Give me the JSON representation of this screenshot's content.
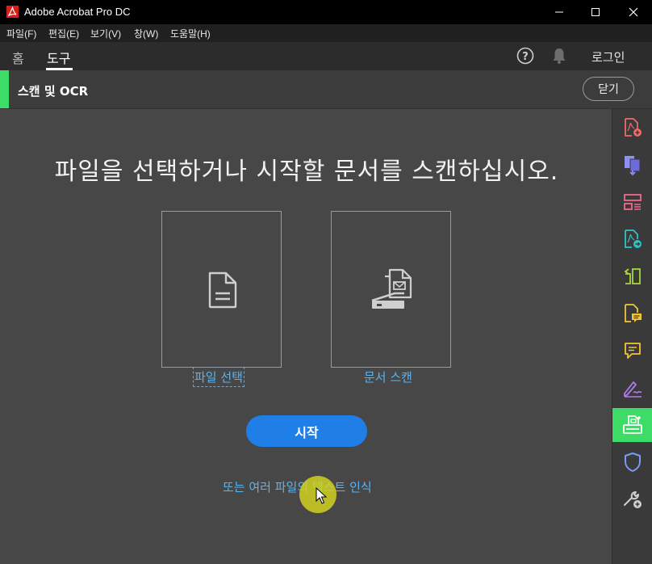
{
  "window": {
    "title": "Adobe Acrobat Pro DC"
  },
  "menu": [
    "파일(F)",
    "편집(E)",
    "보기(V)",
    "창(W)",
    "도움말(H)"
  ],
  "nav": {
    "tabs": [
      {
        "label": "홈"
      },
      {
        "label": "도구",
        "active": true
      }
    ],
    "login": "로그인"
  },
  "tool": {
    "title": "스캔 및 OCR",
    "close_label": "닫기",
    "accent_color": "#3cdc66"
  },
  "main": {
    "heading": "파일을 선택하거나 시작할 문서를 스캔하십시오.",
    "select_file_label": "파일 선택",
    "scan_document_label": "문서 스캔",
    "start_label": "시작",
    "ocr_link": "또는 여러 파일의 텍스트 인식"
  },
  "right_tools": [
    {
      "icon": "create-pdf-icon",
      "color": "#f06a6a"
    },
    {
      "icon": "combine-files-icon",
      "color": "#8f8ff5"
    },
    {
      "icon": "organize-pages-icon",
      "color": "#f06a8a"
    },
    {
      "icon": "export-pdf-icon",
      "color": "#2ec4c4"
    },
    {
      "icon": "edit-pdf-icon",
      "color": "#a6d83a"
    },
    {
      "icon": "comment-file-icon",
      "color": "#f5c431"
    },
    {
      "icon": "comment-icon",
      "color": "#f5c431"
    },
    {
      "icon": "fill-sign-icon",
      "color": "#b07af0"
    },
    {
      "icon": "scan-ocr-icon",
      "color": "#ffffff",
      "active": true
    },
    {
      "icon": "protect-icon",
      "color": "#7a9af5"
    },
    {
      "icon": "more-tools-icon",
      "color": "#d0d0d0"
    }
  ]
}
